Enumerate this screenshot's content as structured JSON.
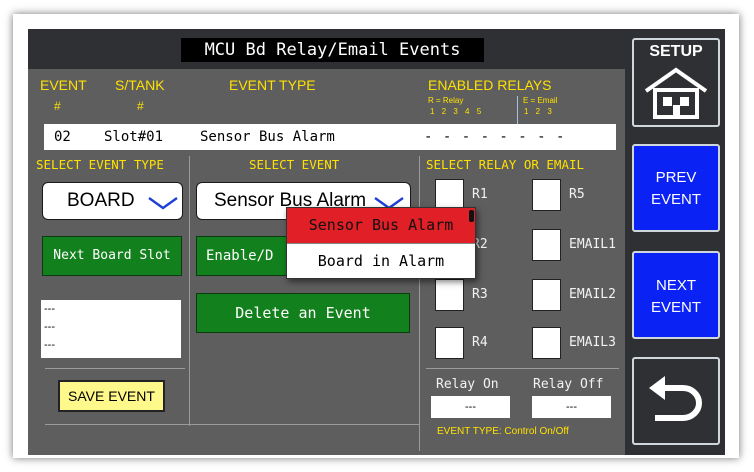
{
  "title": "MCU Bd Relay/Email Events",
  "headers": {
    "event": "EVENT",
    "event_hash": "#",
    "stank": "S/TANK",
    "stank_hash": "#",
    "event_type": "EVENT TYPE",
    "enabled_relays": "ENABLED RELAYS",
    "r_legend": "R = Relay",
    "e_legend": "E = Email",
    "r_nums": "1 2 3 4 5",
    "e_nums": "1 2 3"
  },
  "event_row": {
    "number": "02",
    "slot": "Slot#01",
    "type": "Sensor Bus Alarm",
    "relays": "- - - - - - - -"
  },
  "sections": {
    "select_event_type": "SELECT EVENT TYPE",
    "select_event": "SELECT EVENT",
    "select_relay_or_email": "SELECT RELAY OR EMAIL"
  },
  "event_type_dropdown": {
    "value": "BOARD"
  },
  "event_dropdown": {
    "value": "Sensor Bus Alarm"
  },
  "buttons": {
    "next_board_slot": "Next Board Slot",
    "enable_disable": "Enable/D",
    "delete_event": "Delete an Event",
    "save_event": "SAVE EVENT"
  },
  "event_list": [
    "---",
    "---",
    "---"
  ],
  "relays": {
    "r1": "R1",
    "r2": "R2",
    "r3": "R3",
    "r4": "R4",
    "r5": "R5",
    "email1": "EMAIL1",
    "email2": "EMAIL2",
    "email3": "EMAIL3"
  },
  "relay_times": {
    "on_label": "Relay On",
    "off_label": "Relay Off",
    "on_value": "---",
    "off_value": "---"
  },
  "event_type_footer": "EVENT TYPE: Control On/Off",
  "popup": {
    "options": [
      "Sensor Bus Alarm",
      "Board in Alarm"
    ],
    "selected_index": 0
  },
  "side_panel": {
    "setup": "SETUP",
    "prev_line1": "PREV",
    "prev_line2": "EVENT",
    "next_line1": "NEXT",
    "next_line2": "EVENT"
  },
  "colors": {
    "panel_gray": "#5e5e5e",
    "dark_bar": "#2e3033",
    "header_yellow": "#ffe100",
    "button_green": "#12801d",
    "popup_red": "#e11f26",
    "nav_blue": "#0b22f5",
    "save_yellow": "#fff88a"
  },
  "icons": {
    "setup": "house-icon",
    "dropdown": "chevron-down-icon",
    "back": "back-arrow-icon"
  }
}
